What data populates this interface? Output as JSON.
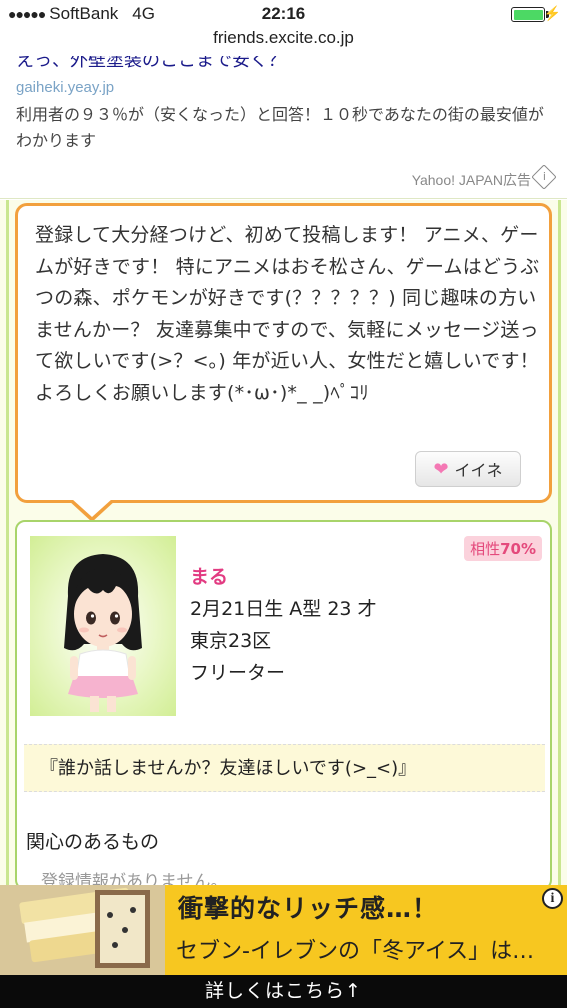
{
  "status_bar": {
    "signal_dots": "●●●●●",
    "carrier": "SoftBank",
    "network": "4G",
    "time": "22:16",
    "battery_level": 1.0
  },
  "url_bar": {
    "domain": "friends.excite.co.jp"
  },
  "top_ad": {
    "headline_cut": "えっ、外壁塗装のここまで安く？",
    "domain": "gaiheki.yeay.jp",
    "description": "利用者の９３％が（安くなった）と回答！１０秒であなたの街の最安値がわかります",
    "source": "Yahoo! JAPAN広告"
  },
  "post": {
    "body": "登録して大分経つけど、初めて投稿します！ アニメ、ゲームが好きです！ 特にアニメはおそ松さん、ゲームはどうぶつの森、ポケモンが好きです(？？？？？) 同じ趣味の方いませんかー？ 友達募集中ですので、気軽にメッセージ送って欲しいです(>？<｡) 年が近い人、女性だと嬉しいです！ よろしくお願いします(*･ω･)*_ _)ﾍﾟｺﾘ",
    "like_label": "イイネ"
  },
  "profile": {
    "compat_label": "相性",
    "compat_value": "70%",
    "name": "まる",
    "details": "2月21日生 A型 23 才",
    "location": "東京23区",
    "occupation": "フリーター",
    "message": "『誰か話しませんか？友達ほしいです(>_<)』",
    "interests_heading": "関心のあるもの",
    "interests_empty": "登録情報がありません。"
  },
  "bottom_ad": {
    "title": "衝撃的なリッチ感…！",
    "subtitle": "セブン-イレブンの「冬アイス」は…",
    "cta": "詳しくはこちら↑"
  },
  "colors": {
    "orange_border": "#f2a03d",
    "green_border": "#a8d46a",
    "name_pink": "#e23b82",
    "ad_yellow": "#f7c720"
  }
}
